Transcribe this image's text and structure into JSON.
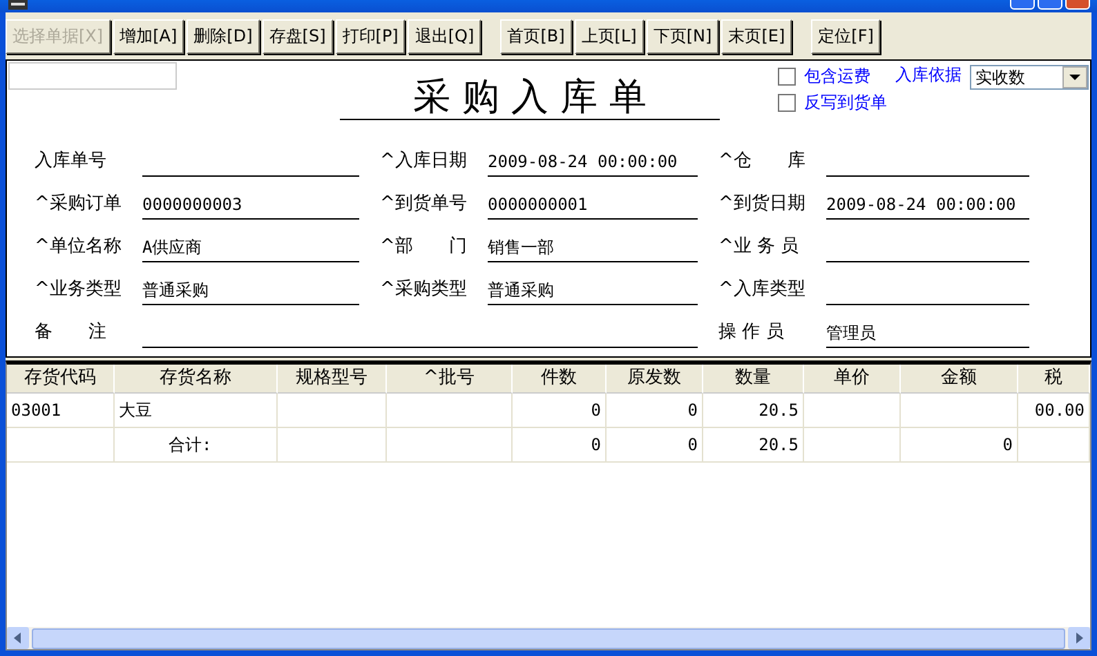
{
  "toolbar_groups": [
    {
      "buttons": [
        {
          "label": "选择单据[X]",
          "disabled": true
        },
        {
          "label": "增加[A]",
          "disabled": false
        },
        {
          "label": "删除[D]",
          "disabled": false
        },
        {
          "label": "存盘[S]",
          "disabled": false
        },
        {
          "label": "打印[P]",
          "disabled": false
        },
        {
          "label": "退出[Q]",
          "disabled": false
        }
      ]
    },
    {
      "buttons": [
        {
          "label": "首页[B]",
          "disabled": false
        },
        {
          "label": "上页[L]",
          "disabled": false
        },
        {
          "label": "下页[N]",
          "disabled": false
        },
        {
          "label": "末页[E]",
          "disabled": false
        }
      ]
    },
    {
      "buttons": [
        {
          "label": "定位[F]",
          "disabled": false
        }
      ]
    }
  ],
  "form": {
    "title": "采 购 入 库 单",
    "options": [
      {
        "label": "包含运费",
        "checked": false
      },
      {
        "label": "反写到货单",
        "checked": false
      }
    ],
    "basis_label": "入库依据",
    "basis_value": "实收数",
    "fields": [
      {
        "label": "入库单号",
        "wide": false
      },
      {
        "label": "^入库日期",
        "value": "2009-08-24 00:00:00",
        "wide": false
      },
      {
        "label": "^仓　　库",
        "wide": false
      },
      {
        "label": "^采购订单",
        "value": "0000000003",
        "wide": false
      },
      {
        "label": "^到货单号",
        "value": "0000000001",
        "wide": false
      },
      {
        "label": "^到货日期",
        "value": "2009-08-24 00:00:00",
        "wide": false
      },
      {
        "label": "^单位名称",
        "value": "A供应商",
        "wide": false
      },
      {
        "label": "^部　　门",
        "value": "销售一部",
        "wide": false
      },
      {
        "label": "^业 务 员",
        "wide": false
      },
      {
        "label": "^业务类型",
        "value": "普通采购",
        "wide": false
      },
      {
        "label": "^采购类型",
        "value": "普通采购",
        "wide": false
      },
      {
        "label": "^入库类型",
        "wide": false
      },
      {
        "label": "备　　注",
        "wide": true
      },
      {
        "label": "操 作 员",
        "value": "管理员",
        "wide": false
      }
    ]
  },
  "table": {
    "columns": [
      {
        "label": "存货代码",
        "kind": "text"
      },
      {
        "label": "存货名称",
        "kind": "text"
      },
      {
        "label": "规格型号",
        "kind": "text"
      },
      {
        "label": "^批号",
        "kind": "text"
      },
      {
        "label": "件数",
        "kind": "number"
      },
      {
        "label": "原发数",
        "kind": "number"
      },
      {
        "label": "数量",
        "kind": "number"
      },
      {
        "label": "单价",
        "kind": "number"
      },
      {
        "label": "金额",
        "kind": "number"
      },
      {
        "label": "税",
        "kind": "number"
      }
    ],
    "rows": [
      {
        "cells": [
          "03001",
          "大豆",
          "",
          "",
          "0",
          "0",
          "20.5",
          "",
          "",
          "00.00"
        ]
      },
      {
        "cells": [
          "",
          "　　　合计:",
          "",
          "",
          "0",
          "0",
          "20.5",
          "",
          "0",
          ""
        ]
      }
    ]
  }
}
